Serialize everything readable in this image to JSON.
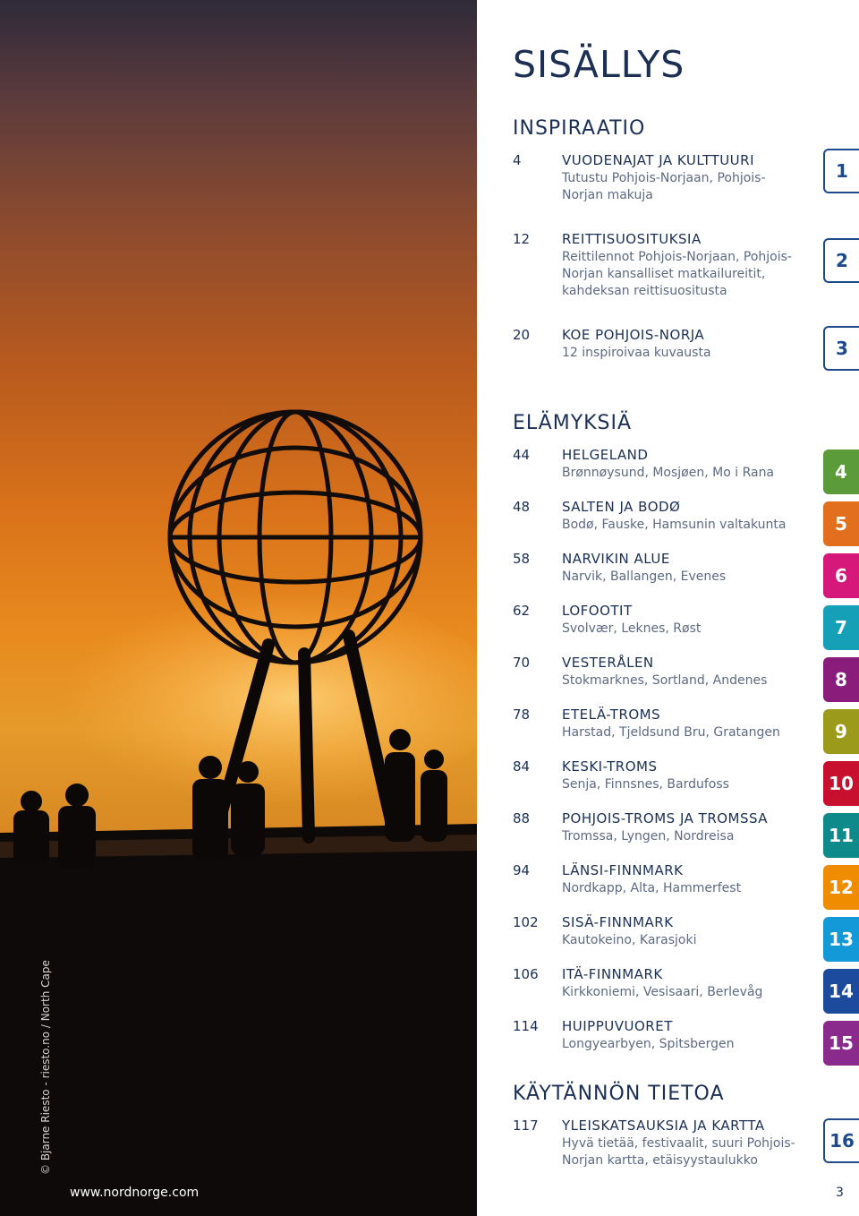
{
  "photo": {
    "credit": "© Bjarne Riesto - riesto.no / North Cape",
    "url": "www.nordnorge.com"
  },
  "title": "SISÄLLYS",
  "sections": {
    "inspiraatio": "INSPIRAATIO",
    "elamyksia": "ELÄMYKSIÄ",
    "kaytannon": "KÄYTÄNNÖN TIETOA"
  },
  "entries": [
    {
      "page": "4",
      "heading": "VUODENAJAT JA KULTTUURI",
      "sub": "Tutustu Pohjois-Norjaan, Pohjois-Norjan makuja"
    },
    {
      "page": "12",
      "heading": "REITTISUOSITUKSIA",
      "sub": "Reittilennot Pohjois-Norjaan, Pohjois-Norjan kansalliset matkailureitit, kahdeksan reittisuositusta"
    },
    {
      "page": "20",
      "heading": "KOE POHJOIS-NORJA",
      "sub": "12 inspiroivaa kuvausta"
    },
    {
      "page": "44",
      "heading": "HELGELAND",
      "sub": "Brønnøysund, Mosjøen, Mo i Rana"
    },
    {
      "page": "48",
      "heading": "SALTEN JA BODØ",
      "sub": "Bodø, Fauske, Hamsunin valtakunta"
    },
    {
      "page": "58",
      "heading": "NARVIKIN ALUE",
      "sub": "Narvik, Ballangen, Evenes"
    },
    {
      "page": "62",
      "heading": "LOFOOTIT",
      "sub": "Svolvær, Leknes, Røst"
    },
    {
      "page": "70",
      "heading": "VESTERÅLEN",
      "sub": "Stokmarknes, Sortland, Andenes"
    },
    {
      "page": "78",
      "heading": "ETELÄ-TROMS",
      "sub": "Harstad, Tjeldsund Bru, Gratangen"
    },
    {
      "page": "84",
      "heading": "KESKI-TROMS",
      "sub": "Senja, Finnsnes, Bardufoss"
    },
    {
      "page": "88",
      "heading": "POHJOIS-TROMS JA TROMSSA",
      "sub": "Tromssa, Lyngen, Nordreisa"
    },
    {
      "page": "94",
      "heading": "LÄNSI-FINNMARK",
      "sub": "Nordkapp, Alta, Hammerfest"
    },
    {
      "page": "102",
      "heading": "SISÄ-FINNMARK",
      "sub": "Kautokeino, Karasjoki"
    },
    {
      "page": "106",
      "heading": "ITÄ-FINNMARK",
      "sub": "Kirkkoniemi, Vesisaari, Berlevåg"
    },
    {
      "page": "114",
      "heading": "HUIPPUVUORET",
      "sub": "Longyearbyen, Spitsbergen"
    },
    {
      "page": "117",
      "heading": "YLEISKATSAUKSIA JA KARTTA",
      "sub": "Hyvä tietää, festivaalit, suuri Pohjois-Norjan kartta, etäisyystaulukko"
    }
  ],
  "tabs": [
    {
      "label": "1",
      "style": "outline",
      "color": "#1c4a8c"
    },
    {
      "label": "2",
      "style": "outline",
      "color": "#1c4a8c"
    },
    {
      "label": "3",
      "style": "outline",
      "color": "#1c4a8c"
    },
    {
      "label": "4",
      "style": "fill",
      "color": "#5b9b3a"
    },
    {
      "label": "5",
      "style": "fill",
      "color": "#e26f1e"
    },
    {
      "label": "6",
      "style": "fill",
      "color": "#d6187a"
    },
    {
      "label": "7",
      "style": "fill",
      "color": "#16a0b8"
    },
    {
      "label": "8",
      "style": "fill",
      "color": "#8a1d7c"
    },
    {
      "label": "9",
      "style": "fill",
      "color": "#9b9a1a"
    },
    {
      "label": "10",
      "style": "fill",
      "color": "#c8102e"
    },
    {
      "label": "11",
      "style": "fill",
      "color": "#0e8a8a"
    },
    {
      "label": "12",
      "style": "fill",
      "color": "#f08c00"
    },
    {
      "label": "13",
      "style": "fill",
      "color": "#1398d8"
    },
    {
      "label": "14",
      "style": "fill",
      "color": "#1c4a9c"
    },
    {
      "label": "15",
      "style": "fill",
      "color": "#8a2a8c"
    },
    {
      "label": "16",
      "style": "outline",
      "color": "#1c4a8c"
    }
  ],
  "page_number": "3"
}
